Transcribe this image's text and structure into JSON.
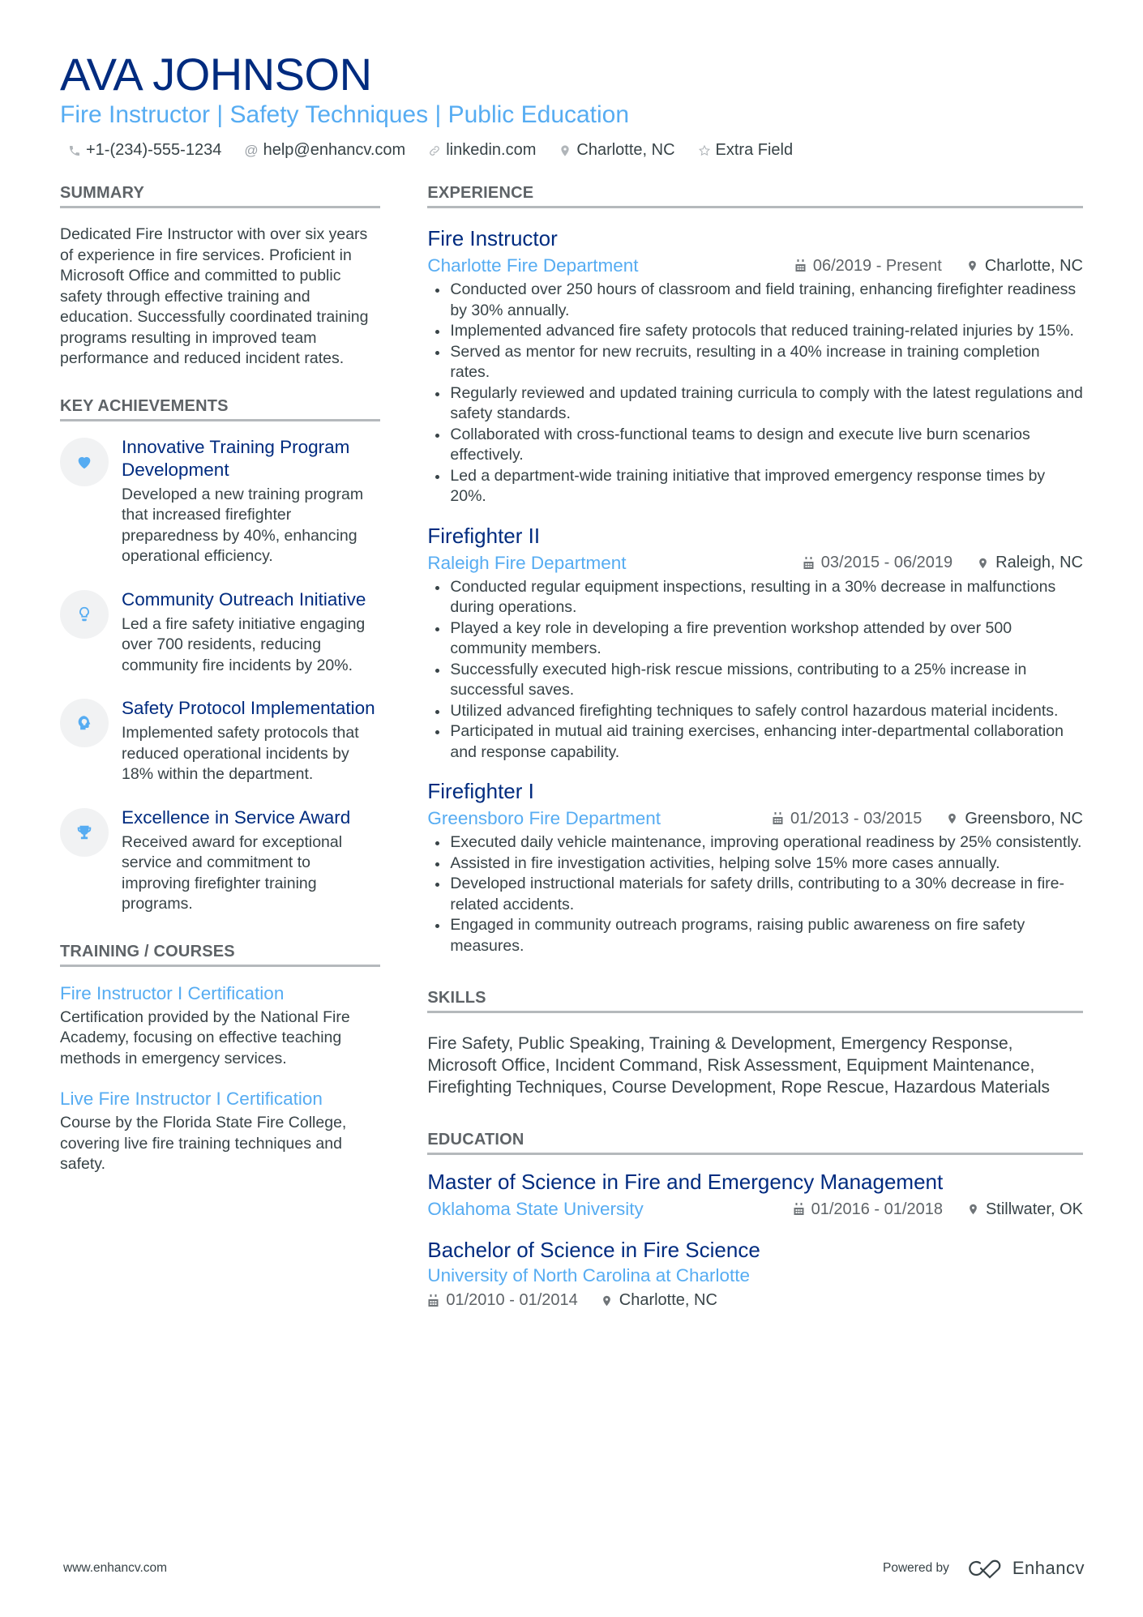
{
  "header": {
    "name": "AVA JOHNSON",
    "headline": "Fire Instructor | Safety Techniques | Public Education",
    "contacts": [
      {
        "icon": "phone-icon",
        "text": "+1-(234)-555-1234"
      },
      {
        "icon": "at-icon",
        "text": "help@enhancv.com"
      },
      {
        "icon": "link-icon",
        "text": "linkedin.com"
      },
      {
        "icon": "location-pin-icon",
        "text": "Charlotte, NC"
      },
      {
        "icon": "star-icon",
        "text": "Extra Field"
      }
    ]
  },
  "colors": {
    "primary": "#002b7f",
    "accent": "#56acf2",
    "text": "#384347",
    "divider": "#b5b9bc"
  },
  "summary": {
    "title": "SUMMARY",
    "text": "Dedicated Fire Instructor with over six years of experience in fire services. Proficient in Microsoft Office and committed to public safety through effective training and education. Successfully coordinated training programs resulting in improved team performance and reduced incident rates."
  },
  "achievements": {
    "title": "KEY ACHIEVEMENTS",
    "items": [
      {
        "icon": "heart-icon",
        "title": "Innovative Training Program Development",
        "text": "Developed a new training program that increased firefighter preparedness by 40%, enhancing operational efficiency."
      },
      {
        "icon": "lightbulb-icon",
        "title": "Community Outreach Initiative",
        "text": "Led a fire safety initiative engaging over 700 residents, reducing community fire incidents by 20%."
      },
      {
        "icon": "head-brain-icon",
        "title": "Safety Protocol Implementation",
        "text": "Implemented safety protocols that reduced operational incidents by 18% within the department."
      },
      {
        "icon": "trophy-icon",
        "title": "Excellence in Service Award",
        "text": "Received award for exceptional service and commitment to improving firefighter training programs."
      }
    ]
  },
  "training": {
    "title": "TRAINING / COURSES",
    "items": [
      {
        "title": "Fire Instructor I Certification",
        "text": "Certification provided by the National Fire Academy, focusing on effective teaching methods in emergency services."
      },
      {
        "title": "Live Fire Instructor I Certification",
        "text": "Course by the Florida State Fire College, covering live fire training techniques and safety."
      }
    ]
  },
  "experience": {
    "title": "EXPERIENCE",
    "jobs": [
      {
        "title": "Fire Instructor",
        "company": "Charlotte Fire Department",
        "dates": "06/2019 - Present",
        "location": "Charlotte, NC",
        "bullets": [
          "Conducted over 250 hours of classroom and field training, enhancing firefighter readiness by 30% annually.",
          "Implemented advanced fire safety protocols that reduced training-related injuries by 15%.",
          "Served as mentor for new recruits, resulting in a 40% increase in training completion rates.",
          "Regularly reviewed and updated training curricula to comply with the latest regulations and safety standards.",
          "Collaborated with cross-functional teams to design and execute live burn scenarios effectively.",
          "Led a department-wide training initiative that improved emergency response times by 20%."
        ]
      },
      {
        "title": "Firefighter II",
        "company": "Raleigh Fire Department",
        "dates": "03/2015 - 06/2019",
        "location": "Raleigh, NC",
        "bullets": [
          "Conducted regular equipment inspections, resulting in a 30% decrease in malfunctions during operations.",
          "Played a key role in developing a fire prevention workshop attended by over 500 community members.",
          "Successfully executed high-risk rescue missions, contributing to a 25% increase in successful saves.",
          "Utilized advanced firefighting techniques to safely control hazardous material incidents.",
          "Participated in mutual aid training exercises, enhancing inter-departmental collaboration and response capability."
        ]
      },
      {
        "title": "Firefighter I",
        "company": "Greensboro Fire Department",
        "dates": "01/2013 - 03/2015",
        "location": "Greensboro, NC",
        "bullets": [
          "Executed daily vehicle maintenance, improving operational readiness by 25% consistently.",
          "Assisted in fire investigation activities, helping solve 15% more cases annually.",
          "Developed instructional materials for safety drills, contributing to a 30% decrease in fire-related accidents.",
          "Engaged in community outreach programs, raising public awareness on fire safety measures."
        ]
      }
    ]
  },
  "skills": {
    "title": "SKILLS",
    "text": "Fire Safety, Public Speaking, Training & Development, Emergency Response, Microsoft Office, Incident Command, Risk Assessment, Equipment Maintenance, Firefighting Techniques, Course Development, Rope Rescue, Hazardous Materials"
  },
  "education": {
    "title": "EDUCATION",
    "items": [
      {
        "degree": "Master of Science in Fire and Emergency Management",
        "school": "Oklahoma State University",
        "dates": "01/2016 - 01/2018",
        "location": "Stillwater, OK"
      },
      {
        "degree": "Bachelor of Science in Fire Science",
        "school": "University of North Carolina at Charlotte",
        "dates": "01/2010 - 01/2014",
        "location": "Charlotte, NC"
      }
    ]
  },
  "footer": {
    "url": "www.enhancv.com",
    "powered_by": "Powered by",
    "brand": "Enhancv"
  }
}
